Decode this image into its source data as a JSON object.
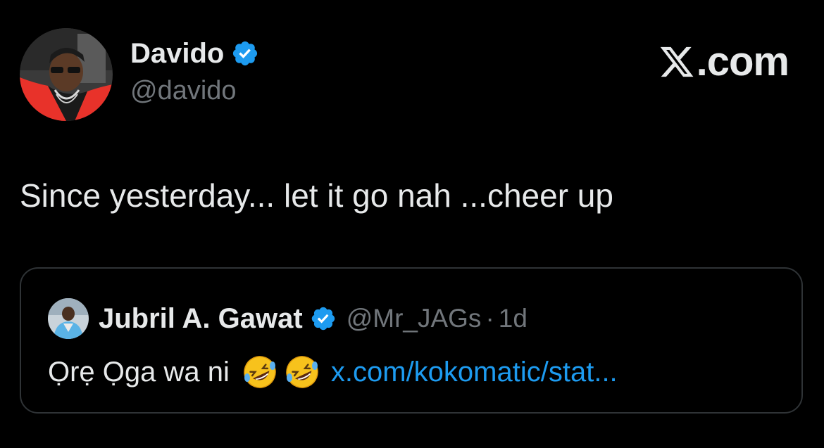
{
  "brand": {
    "text": ".com",
    "x_icon": "x-logo-icon"
  },
  "tweet": {
    "author": {
      "name": "Davido",
      "handle": "@davido",
      "verified_icon": "verified-badge-icon"
    },
    "text": "Since yesterday... let it go nah ...cheer up",
    "quote": {
      "author": {
        "name": "Jubril A. Gawat",
        "handle": "@Mr_JAGs",
        "separator": "·",
        "time": "1d"
      },
      "text": "Ọrẹ Ọga wa ni",
      "emojis": [
        "rolling-on-floor-laughing-emoji",
        "rolling-on-floor-laughing-emoji"
      ],
      "link": "x.com/kokomatic/stat..."
    }
  },
  "colors": {
    "background": "#000000",
    "primary_text": "#e7e9ea",
    "secondary_text": "#71767b",
    "link": "#1d9bf0",
    "verified": "#1d9bf0",
    "card_border": "#2f3336"
  }
}
